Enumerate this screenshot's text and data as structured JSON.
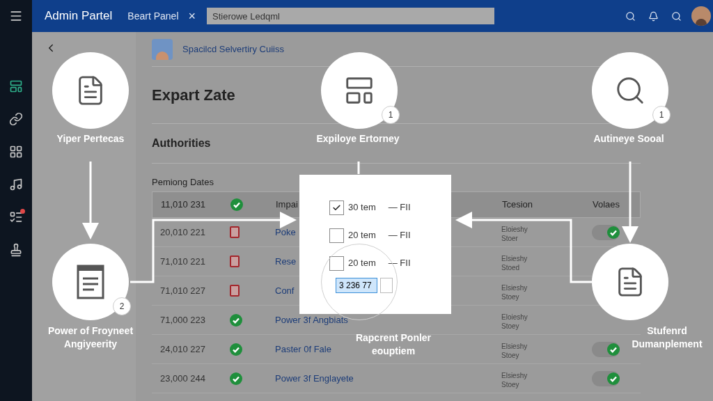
{
  "top_bar": {
    "title": "Admin Partel",
    "tab": "Beart Panel",
    "close": "×",
    "search": {
      "value": "Stierowe Ledqml"
    }
  },
  "sidebar": {
    "items": [
      {
        "selected": true
      },
      {
        "selected": false
      },
      {
        "selected": false
      },
      {
        "selected": false
      },
      {
        "selected": false,
        "alert": true
      },
      {
        "selected": false
      }
    ]
  },
  "header": {
    "title": "Spacilcd Selvertiry Cuiiss"
  },
  "page_title": "Expart Zate",
  "section_title": "Authorities",
  "table_title": "Pemiong Dates",
  "table": {
    "header": {
      "id": "11,010 231",
      "kind": "ok",
      "name": "Impai",
      "column_4": "Tcesion",
      "column_5": "Volaes"
    },
    "rows": [
      {
        "id": "20,010 221",
        "kind": "alert",
        "name": "Poke",
        "column_4": [
          "Eloieshy",
          "Stoer"
        ],
        "on": true
      },
      {
        "id": "71,010 221",
        "kind": "alert",
        "name": "Rese",
        "column_4": [
          "Elsieshy",
          "Stoed"
        ]
      },
      {
        "id": "71,010 227",
        "kind": "alert",
        "name": "Conf",
        "column_4": [
          "Elsieshy",
          "Stoey"
        ]
      },
      {
        "id": "71,000 223",
        "kind": "ok",
        "name": "Power 3f Angbiats",
        "column_4": [
          "Eloieshy",
          "Stoey"
        ]
      },
      {
        "id": "24,010 227",
        "kind": "ok",
        "name": "Paster 0f Fale",
        "column_4": [
          "Elsieshy",
          "Stoey"
        ],
        "on": true
      },
      {
        "id": "23,000 244",
        "kind": "ok",
        "name": "Power 3f Englayete",
        "column_4": [
          "Elsieshy",
          "Stoey"
        ],
        "on": true
      }
    ]
  },
  "popup": {
    "items": [
      {
        "label": "30 tem",
        "suffix": "— FII",
        "checked": true
      },
      {
        "label": "20 tem",
        "suffix": "— FII",
        "checked": false
      },
      {
        "label": "20 tem",
        "suffix": "— FII",
        "checked": false
      }
    ],
    "input": {
      "value": "3 236 77",
      "selected": true
    }
  },
  "nodes": [
    {
      "kind": "document",
      "label": "Yiper Pertecas"
    },
    {
      "kind": "layout",
      "label": "Expiloye Ertorney",
      "badge": "1"
    },
    {
      "kind": "magnifier",
      "label": "Autineye Sooal",
      "badge": "1"
    },
    {
      "kind": "window",
      "label": "Power of Froyneet Angiyeerity",
      "badge": "2"
    },
    {
      "kind": "document",
      "label": "Stufenrd Dumanplement"
    }
  ],
  "popup_label": "Rapcrent Ponler eouptiem"
}
